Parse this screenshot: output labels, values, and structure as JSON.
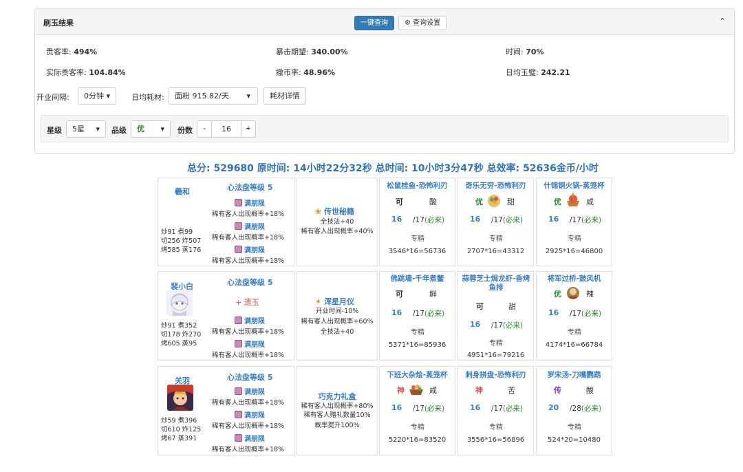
{
  "panel": {
    "title": "刷玉结果",
    "query_btn": "一键查询",
    "settings_btn": "查询设置",
    "settings_icon": "gear-icon",
    "collapse_icon": "chevron-up-icon"
  },
  "stats": {
    "guest_rate_label": "贵客率: ",
    "guest_rate": "494%",
    "crit_label": "暴击期望: ",
    "crit": "340.00%",
    "time_label": "时间: ",
    "time": "70%",
    "actual_guest_label": "实际贵客率: ",
    "actual_guest": "104.84%",
    "coin_label": "撤币率: ",
    "coin": "48.96%",
    "daily_jade_label": "日均玉璧: ",
    "daily_jade": "242.21"
  },
  "controls": {
    "interval_label": "开业间隔:",
    "interval_value": "0分钟",
    "cost_label": "日均耗材:",
    "cost_value": "面粉 915.82/天",
    "cost_detail_btn": "耗材详情"
  },
  "filter": {
    "star_label": "星级",
    "star_value": "5星",
    "grade_label": "品级",
    "grade_value": "优",
    "count_label": "份数",
    "count_minus": "-",
    "count_value": "16",
    "count_plus": "+"
  },
  "summary": "总分: 529680 原时间: 14小时22分32秒 总时间: 10小时3分47秒 总效率: 52636金币/小时",
  "rows": [
    {
      "chef": {
        "name": "羲和",
        "skill": "心法盘等级 5",
        "has_jade": false,
        "jade": "",
        "stats": [
          "炒91  煮99",
          "切256 炸507",
          "烤585 蒸176"
        ],
        "equip": [
          {
            "name": "满朋陨",
            "desc": "稀有客人出现概率+18%"
          },
          {
            "name": "满朋陨",
            "desc": "稀有客人出现概率+18%"
          },
          {
            "name": "满朋陨",
            "desc": "稀有客人出现概率+18%"
          }
        ]
      },
      "equipment": {
        "name": "传世秘籍",
        "desc": [
          "全技法+40",
          "稀有客人出现概率+40%"
        ]
      },
      "dishes": [
        {
          "name": "松鼠桂鱼-恐怖利刃",
          "rank": "可",
          "rank_color": "#333333",
          "flavor": "酸",
          "count": "16",
          "max": "/17",
          "must": "(必来)",
          "skill": "专精",
          "calc": "3546*16=56736",
          "img": false
        },
        {
          "name": "奇乐无穷-恐怖利刃",
          "rank": "优",
          "rank_color": "#2a8a2a",
          "flavor": "甜",
          "count": "16",
          "max": "/17",
          "must": "(必来)",
          "skill": "专精",
          "calc": "2707*16=43312",
          "img": true
        },
        {
          "name": "什锦铜火锅-蒸笼杯",
          "rank": "优",
          "rank_color": "#2a8a2a",
          "flavor": "咸",
          "count": "16",
          "max": "/17",
          "must": "(必来)",
          "skill": "专精",
          "calc": "2925*16=46800",
          "img": true
        }
      ]
    },
    {
      "chef": {
        "name": "裴小白",
        "skill": "心法盘等级 5",
        "has_jade": true,
        "jade": "+ 遗玉",
        "stats": [
          "炒91  煮352",
          "切178 炸270",
          "烤605 蒸95"
        ],
        "equip": [
          {
            "name": "满朋陨",
            "desc": "稀有客人出现概率+18%"
          },
          {
            "name": "满朋陨",
            "desc": "稀有客人出现概率+18%"
          }
        ]
      },
      "equipment": {
        "name": "浑星月仪",
        "desc": [
          "开业时间-10%",
          "稀有客人出现概率+60%",
          "全技法+40"
        ]
      },
      "dishes": [
        {
          "name": "佛跳墙-千年煮鳖",
          "rank": "可",
          "rank_color": "#333333",
          "flavor": "鲜",
          "count": "16",
          "max": "/17",
          "must": "(必来)",
          "skill": "专精",
          "calc": "5371*16=85936",
          "img": false
        },
        {
          "name": "蒜蓉芝士焗龙虾-香烤鱼排",
          "rank": "可",
          "rank_color": "#333333",
          "flavor": "甜",
          "count": "16",
          "max": "/17",
          "must": "(必来)",
          "skill": "专精",
          "calc": "4951*16=79216",
          "img": false
        },
        {
          "name": "将军过桥-鼓风机",
          "rank": "优",
          "rank_color": "#2a8a2a",
          "flavor": "辣",
          "count": "16",
          "max": "/17",
          "must": "(必来)",
          "skill": "专精",
          "calc": "4174*16=66784",
          "img": true
        }
      ]
    },
    {
      "chef": {
        "name": "关羽",
        "skill": "心法盘等级 5",
        "has_jade": false,
        "jade": "",
        "stats": [
          "炒59  煮396",
          "切610 炸125",
          "烤67  蒸391"
        ],
        "equip": [
          {
            "name": "满朋陨",
            "desc": "稀有客人出现概率+18%"
          },
          {
            "name": "满朋陨",
            "desc": "稀有客人出现概率+18%"
          },
          {
            "name": "满朋陨",
            "desc": "稀有客人出现概率+18%"
          }
        ]
      },
      "equipment": {
        "name": "巧克力礼盒",
        "desc": [
          "稀有客人出现概率+80%",
          "稀有客人赠礼数量10%",
          "概率提升100%"
        ]
      },
      "dishes": [
        {
          "name": "下班大杂烩-蒸笼杯",
          "rank": "神",
          "rank_color": "#d9534f",
          "flavor": "咸",
          "count": "16",
          "max": "/17",
          "must": "(必来)",
          "skill": "专精",
          "calc": "5220*16=83520",
          "img": true
        },
        {
          "name": "刺身拼盘-恐怖利刃",
          "rank": "神",
          "rank_color": "#d9534f",
          "flavor": "苦",
          "count": "16",
          "max": "/17",
          "must": "(必来)",
          "skill": "专精",
          "calc": "3556*16=56896",
          "img": false
        },
        {
          "name": "罗宋汤-刀嘴鹦鹉",
          "rank": "传",
          "rank_color": "#8a3ab9",
          "flavor": "酸",
          "count": "20",
          "max": "/28",
          "must": "(必来)",
          "skill": "专精",
          "calc": "524*20=10480",
          "img": false
        }
      ]
    }
  ]
}
